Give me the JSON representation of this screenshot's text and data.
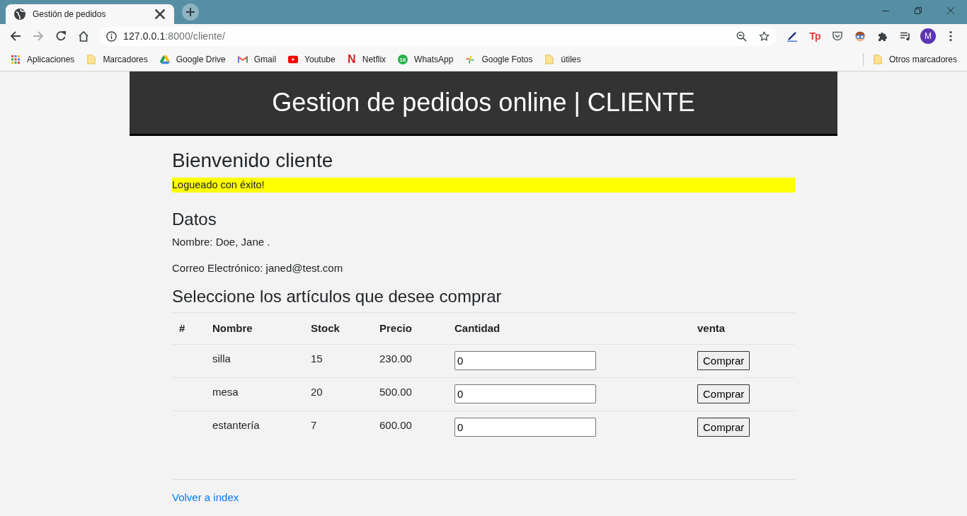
{
  "browser": {
    "tabs": [
      {
        "title": "Gestión de pedidos",
        "selected": true
      }
    ],
    "nav": [
      {
        "kind": "back",
        "disabled": false
      },
      {
        "kind": "forward",
        "disabled": true
      },
      {
        "kind": "reload",
        "disabled": false
      },
      {
        "kind": "home",
        "disabled": false
      }
    ],
    "address": {
      "host": "127.0.0.1",
      "path": ":8000/cliente/"
    },
    "extensions": [
      {
        "kind": "pen"
      },
      {
        "kind": "text",
        "text": "Tp"
      },
      {
        "kind": "pocket"
      },
      {
        "kind": "face"
      },
      {
        "kind": "puzzle"
      },
      {
        "kind": "queue"
      }
    ],
    "profile": {
      "initial": "M"
    },
    "bookmarks": [
      {
        "kind": "apps",
        "label": "Aplicaciones"
      },
      {
        "kind": "folder",
        "label": "Marcadores"
      },
      {
        "kind": "triangle",
        "label": "Google Drive"
      },
      {
        "kind": "envelope",
        "label": "Gmail"
      },
      {
        "kind": "play",
        "label": "Youtube"
      },
      {
        "kind": "letter",
        "glyph": "N",
        "label": "Netflix"
      },
      {
        "kind": "badge",
        "badge": "16",
        "label": "WhatsApp"
      },
      {
        "kind": "pinwheel",
        "label": "Google Fotos"
      },
      {
        "kind": "folder",
        "label": "útiles"
      }
    ],
    "other_bookmarks": {
      "label": "Otros marcadores"
    }
  },
  "page": {
    "header": "Gestion de pedidos online | CLIENTE",
    "welcome": "Bienvenido cliente",
    "alert": "Logueado con éxito!",
    "data_heading": "Datos",
    "details": [
      "Nombre: Doe, Jane .",
      "Correo Electrónico: janed@test.com"
    ],
    "products_heading": "Seleccione los artículos que desee comprar",
    "table": {
      "columns": [
        "#",
        "Nombre",
        "Stock",
        "Precio",
        "Cantidad",
        "venta"
      ],
      "rows": [
        {
          "nombre": "silla",
          "stock": "15",
          "precio": "230.00",
          "cantidad": "0",
          "action": "Comprar"
        },
        {
          "nombre": "mesa",
          "stock": "20",
          "precio": "500.00",
          "cantidad": "0",
          "action": "Comprar"
        },
        {
          "nombre": "estantería",
          "stock": "7",
          "precio": "600.00",
          "cantidad": "0",
          "action": "Comprar"
        }
      ]
    },
    "back_link": "Volver a index"
  }
}
